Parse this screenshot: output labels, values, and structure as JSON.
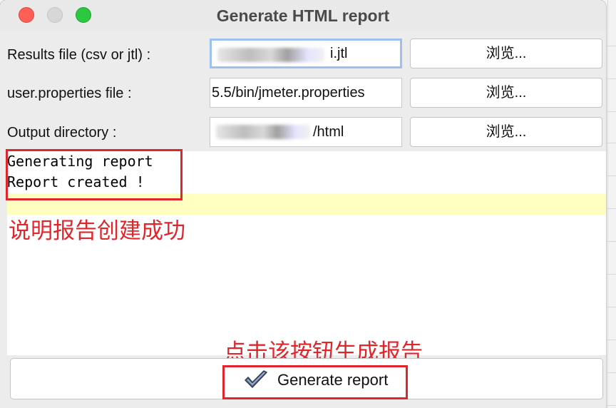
{
  "window": {
    "title": "Generate HTML report",
    "controls": [
      "close",
      "minimize",
      "maximize"
    ]
  },
  "form": {
    "rows": [
      {
        "label": "Results file (csv or jtl) :",
        "value_visible": "i.jtl",
        "value_obscured": true,
        "browse_label": "浏览..."
      },
      {
        "label": "user.properties file :",
        "value_visible": "5.5/bin/jmeter.properties",
        "value_obscured": false,
        "browse_label": "浏览..."
      },
      {
        "label": "Output directory :",
        "value_visible": "/html",
        "value_obscured": true,
        "browse_label": "浏览..."
      }
    ]
  },
  "log": {
    "lines": [
      "Generating report",
      "Report created !"
    ],
    "text": "Generating report\nReport created !"
  },
  "annotations": {
    "success_note": "说明报告创建成功",
    "button_note": "点击该按钮生成报告",
    "color": "#e0252b"
  },
  "generate_button": {
    "label": "Generate report",
    "icon": "check-icon"
  },
  "colors": {
    "highlight_row": "#ffffc0",
    "focus_ring": "#9dc0ee",
    "close": "#fe5f57",
    "maximize": "#2bc840"
  }
}
